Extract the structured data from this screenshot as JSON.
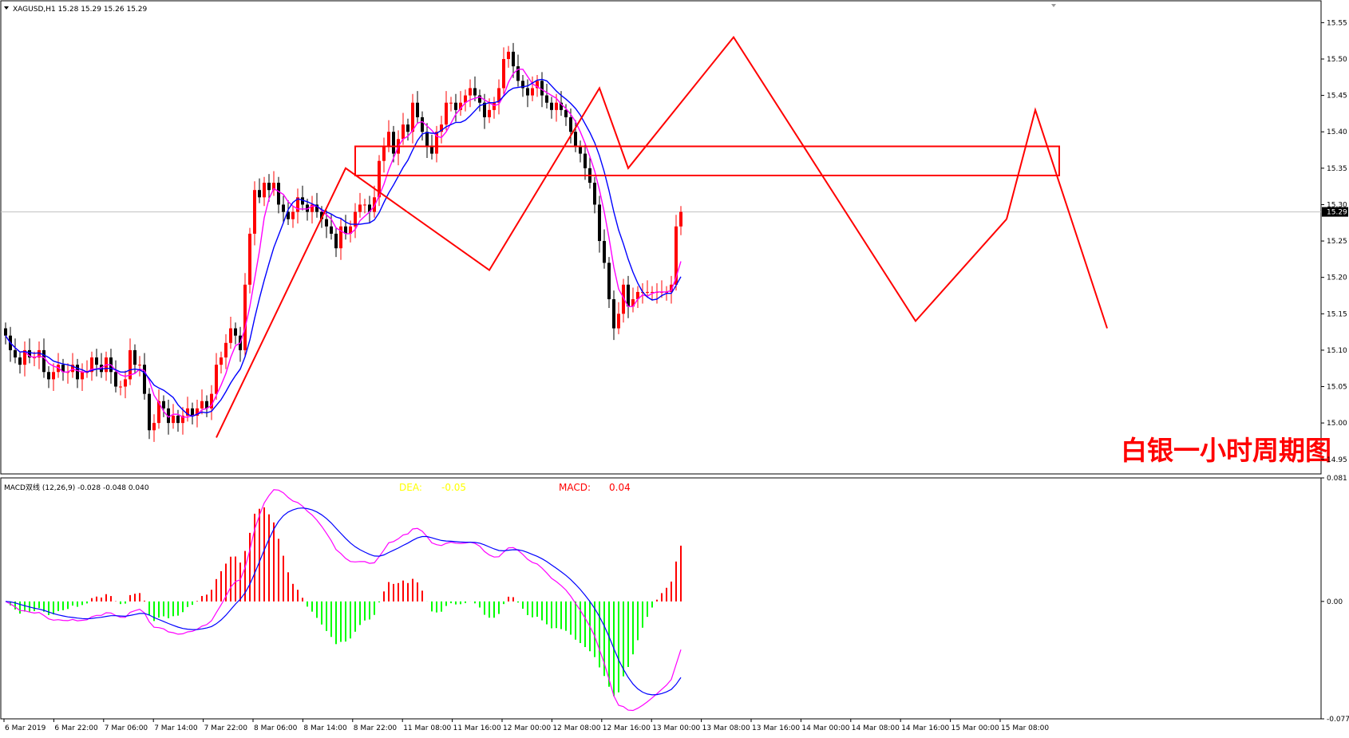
{
  "header": {
    "symbol_line": "XAGUSD,H1  15.28 15.29 15.26 15.29"
  },
  "macd_header": {
    "label": "MACD双线 (12,26,9) -0.028 -0.048 0.040",
    "dea_label": "DEA:",
    "dea_value": "-0.05",
    "macd_label": "MACD:",
    "macd_value": "0.04"
  },
  "annotation": "白银一小时周期图",
  "price_axis": {
    "ticks": [
      "15.55",
      "15.50",
      "15.45",
      "15.40",
      "15.35",
      "15.30",
      "15.25",
      "15.20",
      "15.15",
      "15.10",
      "15.05",
      "15.00",
      "14.95"
    ],
    "current_price": "15.29"
  },
  "macd_axis": {
    "ticks": [
      "0.081",
      "0.00",
      "-0.077"
    ]
  },
  "time_axis": {
    "ticks": [
      "6 Mar 2019",
      "6 Mar 22:00",
      "7 Mar 06:00",
      "7 Mar 14:00",
      "7 Mar 22:00",
      "8 Mar 06:00",
      "8 Mar 14:00",
      "8 Mar 22:00",
      "11 Mar 08:00",
      "11 Mar 16:00",
      "12 Mar 00:00",
      "12 Mar 08:00",
      "12 Mar 16:00",
      "13 Mar 00:00",
      "13 Mar 08:00",
      "13 Mar 16:00",
      "14 Mar 00:00",
      "14 Mar 08:00",
      "14 Mar 16:00",
      "15 Mar 00:00",
      "15 Mar 08:00"
    ]
  },
  "colors": {
    "bull": "#ff0000",
    "bear": "#000000",
    "ma_fast": "#ff00ff",
    "ma_slow": "#0000ff",
    "pattern": "#ff0000",
    "hist_pos": "#ff0000",
    "hist_neg": "#00ff00",
    "dif_line": "#ff00ff",
    "dea_line": "#0000ff",
    "dea_text": "#ffff00",
    "macd_text": "#ff0000"
  },
  "chart_data": [
    {
      "type": "candlestick",
      "title": "XAGUSD,H1",
      "ylim": [
        14.93,
        15.58
      ],
      "current_price": 15.29,
      "closes": [
        15.12,
        15.1,
        15.09,
        15.08,
        15.1,
        15.09,
        15.09,
        15.1,
        15.07,
        15.06,
        15.07,
        15.08,
        15.07,
        15.07,
        15.08,
        15.06,
        15.07,
        15.07,
        15.09,
        15.08,
        15.07,
        15.09,
        15.07,
        15.05,
        15.05,
        15.06,
        15.1,
        15.08,
        15.08,
        15.04,
        14.99,
        15.0,
        15.03,
        15.02,
        15.0,
        15.01,
        15.0,
        15.01,
        15.02,
        15.01,
        15.02,
        15.03,
        15.02,
        15.04,
        15.08,
        15.09,
        15.11,
        15.13,
        15.12,
        15.1,
        15.19,
        15.26,
        15.32,
        15.31,
        15.33,
        15.32,
        15.33,
        15.3,
        15.29,
        15.28,
        15.29,
        15.31,
        15.3,
        15.29,
        15.3,
        15.29,
        15.28,
        15.27,
        15.26,
        15.24,
        15.27,
        15.26,
        15.27,
        15.29,
        15.3,
        15.3,
        15.29,
        15.31,
        15.36,
        15.38,
        15.4,
        15.37,
        15.39,
        15.41,
        15.4,
        15.44,
        15.42,
        15.4,
        15.38,
        15.37,
        15.4,
        15.41,
        15.44,
        15.44,
        15.43,
        15.44,
        15.45,
        15.46,
        15.45,
        15.44,
        15.42,
        15.43,
        15.44,
        15.46,
        15.5,
        15.51,
        15.49,
        15.47,
        15.46,
        15.45,
        15.46,
        15.47,
        15.45,
        15.44,
        15.43,
        15.44,
        15.43,
        15.42,
        15.4,
        15.38,
        15.37,
        15.35,
        15.33,
        15.3,
        15.25,
        15.22,
        15.17,
        15.13,
        15.15,
        15.19,
        15.16,
        15.17,
        15.18,
        15.18,
        15.18,
        15.18,
        15.18,
        15.18,
        15.18,
        15.19,
        15.27,
        15.29
      ],
      "ma_fast_label": "MA fast (magenta)",
      "ma_slow_label": "MA slow (blue)",
      "pattern_zigzag": [
        {
          "bar": 44,
          "price": 14.98
        },
        {
          "bar": 71,
          "price": 15.35
        },
        {
          "bar": 101,
          "price": 15.21
        },
        {
          "bar": 124,
          "price": 15.46
        },
        {
          "bar": 130,
          "price": 15.35
        },
        {
          "bar": 152,
          "price": 15.53
        },
        {
          "bar": 190,
          "price": 15.14
        },
        {
          "bar": 209,
          "price": 15.28
        }
      ],
      "pattern_projection": [
        {
          "bar": 209,
          "price": 15.28
        },
        {
          "bar": 215,
          "price": 15.43
        },
        {
          "bar": 230,
          "price": 15.13
        }
      ],
      "resistance_zone": {
        "bar_start": 73,
        "bar_end": 220,
        "price_low": 15.34,
        "price_high": 15.38
      }
    },
    {
      "type": "bar",
      "title": "MACD双线 (12,26,9)",
      "ylim": [
        -0.077,
        0.081
      ],
      "dif_line_label": "DIF (magenta)",
      "dea_line_label": "DEA (blue)"
    }
  ]
}
